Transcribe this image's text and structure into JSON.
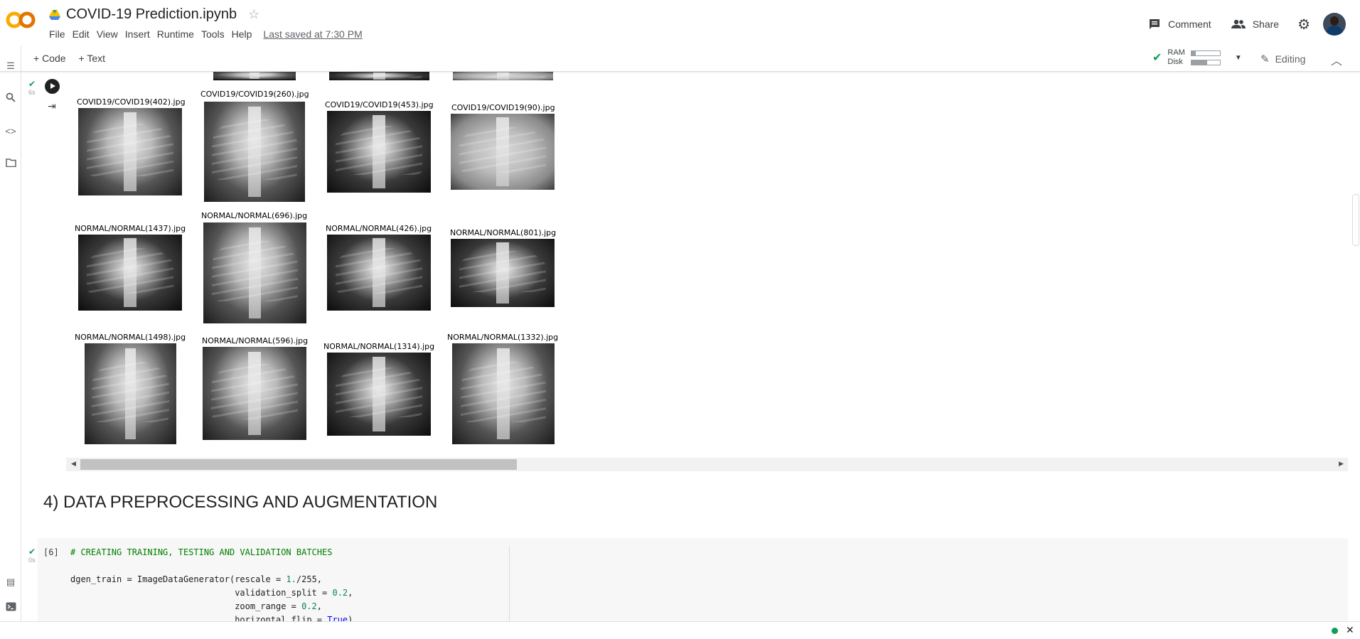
{
  "app": {
    "logo_text": "CO",
    "brand_color_1": "#f9ab00",
    "brand_color_2": "#e37400"
  },
  "header": {
    "title": "COVID-19 Prediction.ipynb",
    "menu": [
      "File",
      "Edit",
      "View",
      "Insert",
      "Runtime",
      "Tools",
      "Help"
    ],
    "last_saved": "Last saved at 7:30 PM",
    "comment_label": "Comment",
    "share_label": "Share"
  },
  "toolbar": {
    "add_code": "+ Code",
    "add_text": "+ Text",
    "ram_label": "RAM",
    "disk_label": "Disk",
    "editing_label": "Editing"
  },
  "output_cell": {
    "exec_time": "6s",
    "rows": [
      [
        "COVID19/COVID19(402).jpg",
        "COVID19/COVID19(260).jpg",
        "COVID19/COVID19(453).jpg",
        "COVID19/COVID19(90).jpg"
      ],
      [
        "NORMAL/NORMAL(1437).jpg",
        "NORMAL/NORMAL(696).jpg",
        "NORMAL/NORMAL(426).jpg",
        "NORMAL/NORMAL(801).jpg"
      ],
      [
        "NORMAL/NORMAL(1498).jpg",
        "NORMAL/NORMAL(596).jpg",
        "NORMAL/NORMAL(1314).jpg",
        "NORMAL/NORMAL(1332).jpg"
      ]
    ]
  },
  "section": {
    "title": "4) DATA PREPROCESSING AND AUGMENTATION"
  },
  "code_cell": {
    "exec_count": "[6]",
    "exec_time": "0s",
    "comment": "# CREATING TRAINING, TESTING AND VALIDATION BATCHES",
    "line1_prefix": "dgen_train = ImageDataGenerator(rescale = ",
    "line1_value": "1.",
    "line1_suffix": "/255,",
    "line1_num": "255",
    "line2_prefix": "                                validation_split = ",
    "line2_value": "0.2",
    "line3_prefix": "                                zoom_range = ",
    "line3_value": "0.2",
    "line4_prefix": "                                horizontal_flip = ",
    "line4_value": "True"
  }
}
